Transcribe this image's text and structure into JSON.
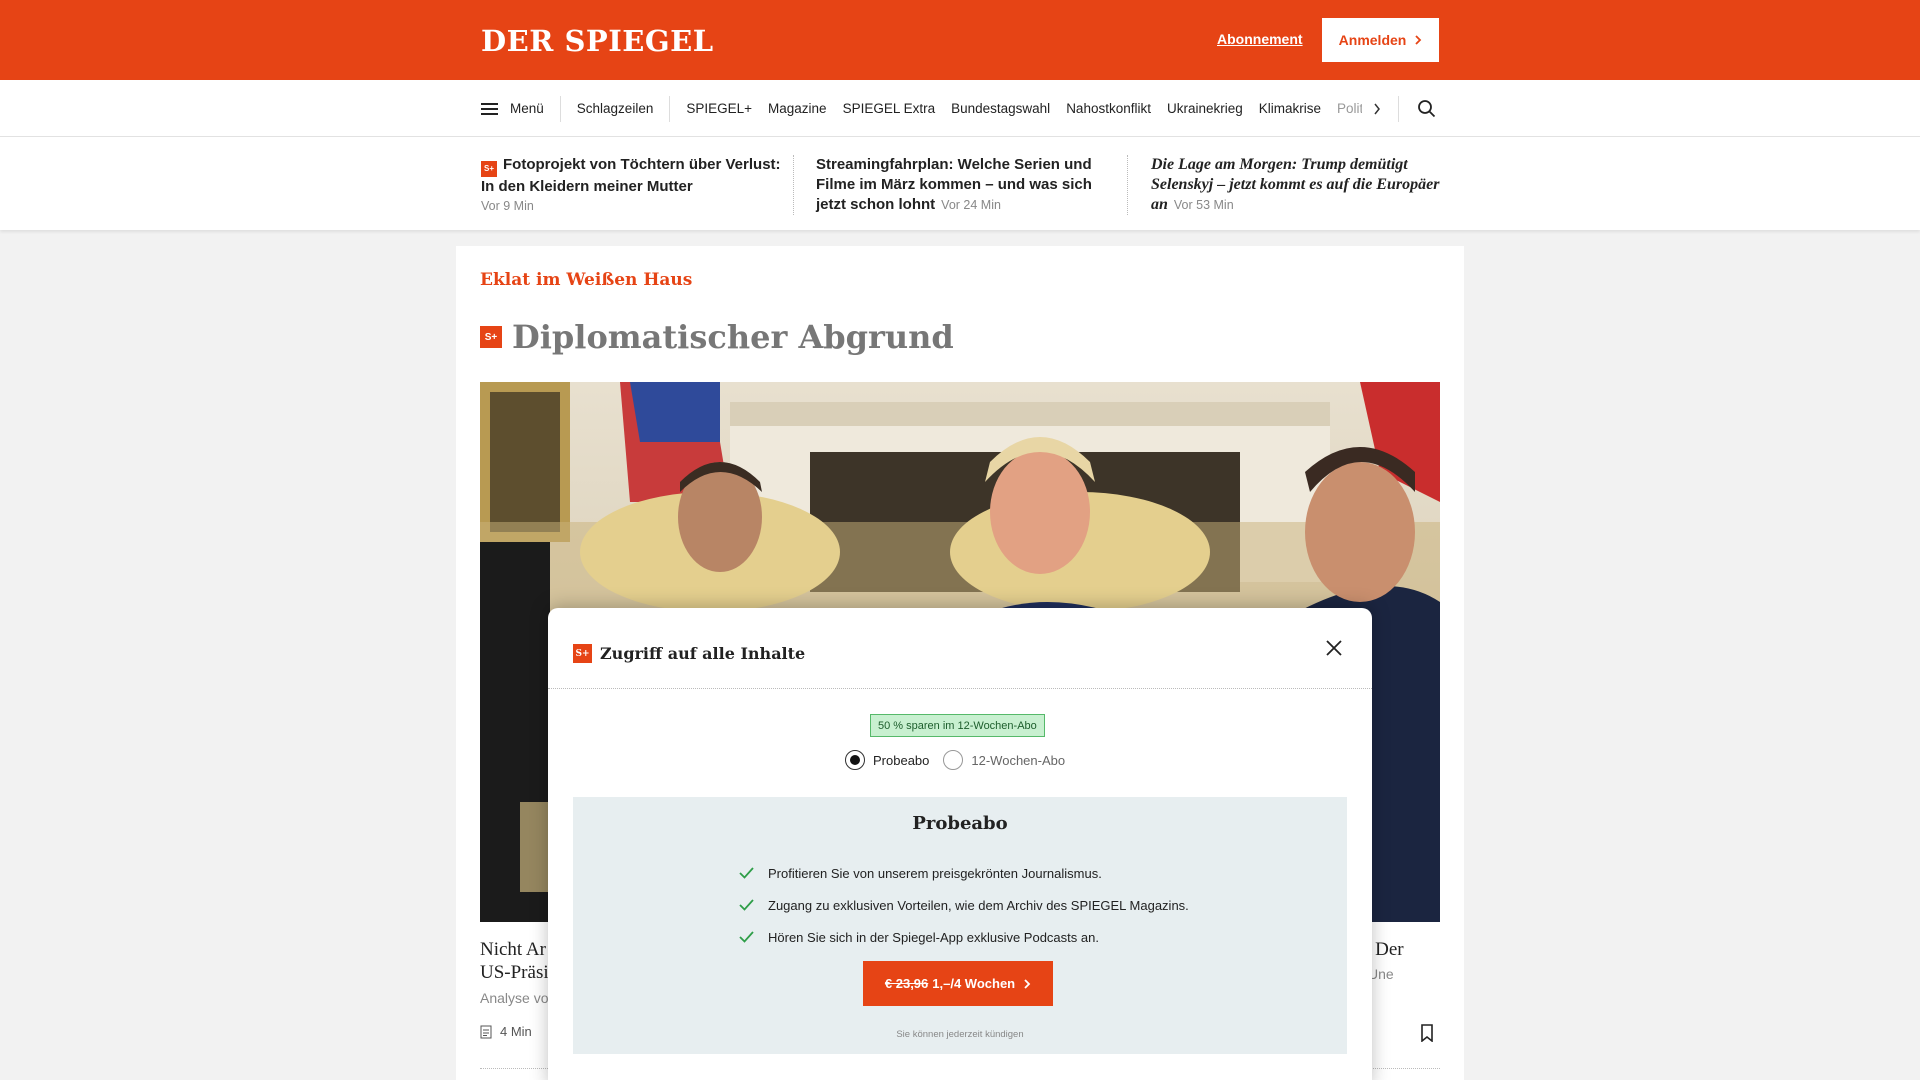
{
  "header": {
    "logo": "DER SPIEGEL",
    "abo_label": "Abonnement",
    "login_label": "Anmelden",
    "brand_color": "#e64415"
  },
  "nav": {
    "menu_label": "Menü",
    "first_item": "Schlagzeilen",
    "items": [
      "SPIEGEL+",
      "Magazine",
      "SPIEGEL Extra",
      "Bundestagswahl",
      "Nahostkonflikt",
      "Ukrainekrieg",
      "Klimakrise",
      "Politik"
    ]
  },
  "teasers": [
    {
      "title": "Fotoprojekt von Töchtern über Verlust: In den Kleidern meiner Mutter",
      "time": "Vor 9 Min",
      "plus": true
    },
    {
      "title": "Streamingfahrplan: Welche Serien und Filme im März kommen – und was sich jetzt schon lohnt",
      "time": "Vor 24 Min",
      "plus": false
    },
    {
      "title": "Die Lage am Morgen: Trump demütigt Selenskyj – jetzt kommt es auf die Europäer an",
      "time": "Vor 53 Min",
      "plus": false
    }
  ],
  "article": {
    "kicker": "Eklat im Weißen Haus",
    "headline": "Diplomatischer Abgrund",
    "caption_left_1": "Nicht Ar",
    "caption_left_2": "US-Präsi",
    "caption_right": "rt. Der",
    "sub_left": "Analyse vo",
    "sub_right": "Une",
    "read_time": "4 Min"
  },
  "modal": {
    "title": "Zugriff auf alle Inhalte",
    "badge": "50 % sparen im 12-Wochen-Abo",
    "options": [
      {
        "label": "Probeabo",
        "selected": true
      },
      {
        "label": "12-Wochen-Abo",
        "selected": false
      }
    ],
    "offer_title": "Probeabo",
    "benefits": [
      "Profitieren Sie von unserem preisgekrönten Journalismus.",
      "Zugang zu exklusiven Vorteilen, wie dem Archiv des SPIEGEL Magazins.",
      "Hören Sie sich in der Spiegel-App exklusive Podcasts an."
    ],
    "cta_old_price": "€ 23,96",
    "cta_new_price": "1,–/4 Wochen",
    "cancel_note": "Sie können jederzeit kündigen"
  }
}
